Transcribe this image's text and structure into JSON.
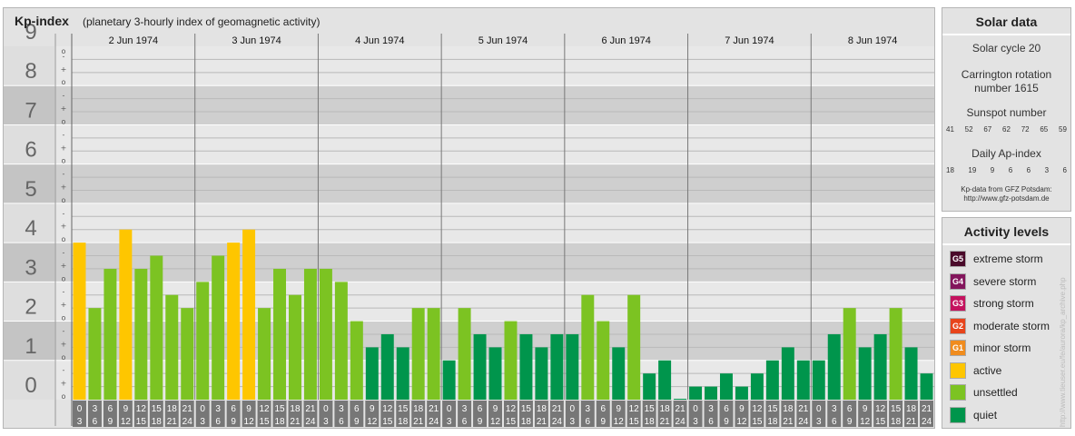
{
  "header": {
    "title": "Kp-index",
    "subtitle": "(planetary 3-hourly index of geomagnetic activity)"
  },
  "chart_data": {
    "type": "bar",
    "y_ticks": [
      "0",
      "1",
      "2",
      "3",
      "4",
      "5",
      "6",
      "7",
      "8",
      "9"
    ],
    "sub_ticks": [
      "o",
      "+",
      "-"
    ],
    "ylim": [
      0,
      9
    ],
    "days": [
      "2 Jun 1974",
      "3 Jun 1974",
      "4 Jun 1974",
      "5 Jun 1974",
      "6 Jun 1974",
      "7 Jun 1974",
      "8 Jun 1974"
    ],
    "hour_start_labels": [
      "0",
      "3",
      "6",
      "9",
      "12",
      "15",
      "18",
      "21"
    ],
    "hour_end_labels": [
      "3",
      "6",
      "9",
      "12",
      "15",
      "18",
      "21",
      "24"
    ],
    "values": [
      4.0,
      2.333,
      3.333,
      4.333,
      3.333,
      3.667,
      2.667,
      2.333,
      3.0,
      3.667,
      4.0,
      4.333,
      2.333,
      3.333,
      2.667,
      3.333,
      3.333,
      3.0,
      2.0,
      1.333,
      1.667,
      1.333,
      2.333,
      2.333,
      1.0,
      2.333,
      1.667,
      1.333,
      2.0,
      1.667,
      1.333,
      1.667,
      1.667,
      2.667,
      2.0,
      1.333,
      2.667,
      0.667,
      1.0,
      0.0,
      0.333,
      0.333,
      0.667,
      0.333,
      0.667,
      1.0,
      1.333,
      1.0,
      1.0,
      1.667,
      2.333,
      1.333,
      1.667,
      2.333,
      1.333,
      0.667
    ]
  },
  "colors": {
    "quiet": "#00954c",
    "unsettled": "#7cc322",
    "active": "#fec600",
    "minor_storm": "#f08c1e",
    "moderate_storm": "#e8441b",
    "strong_storm": "#c4125e",
    "severe_storm": "#83155c",
    "extreme_storm": "#4a0a2a"
  },
  "solar_data": {
    "title": "Solar data",
    "solar_cycle": "Solar cycle 20",
    "carrington_line1": "Carrington rotation",
    "carrington_line2": "number 1615",
    "sunspot_title": "Sunspot number",
    "sunspot_values": [
      "41",
      "52",
      "67",
      "62",
      "72",
      "65",
      "59"
    ],
    "ap_title": "Daily Ap-index",
    "ap_values": [
      "18",
      "19",
      "9",
      "6",
      "6",
      "3",
      "6"
    ],
    "credit_line1": "Kp-data from GFZ Potsdam:",
    "credit_line2": "http://www.gfz-potsdam.de"
  },
  "legend": {
    "title": "Activity levels",
    "items": [
      {
        "code": "G5",
        "label": "extreme storm",
        "color": "#4a0a2a"
      },
      {
        "code": "G4",
        "label": "severe storm",
        "color": "#83155c"
      },
      {
        "code": "G3",
        "label": "strong storm",
        "color": "#c4125e"
      },
      {
        "code": "G2",
        "label": "moderate storm",
        "color": "#e8441b"
      },
      {
        "code": "G1",
        "label": "minor storm",
        "color": "#f08c1e"
      },
      {
        "code": "",
        "label": "active",
        "color": "#fec600"
      },
      {
        "code": "",
        "label": "unsettled",
        "color": "#7cc322"
      },
      {
        "code": "",
        "label": "quiet",
        "color": "#00954c"
      }
    ]
  },
  "watermark": "http://www.tieuser.eu/fe/aurora/kp_archive.php"
}
